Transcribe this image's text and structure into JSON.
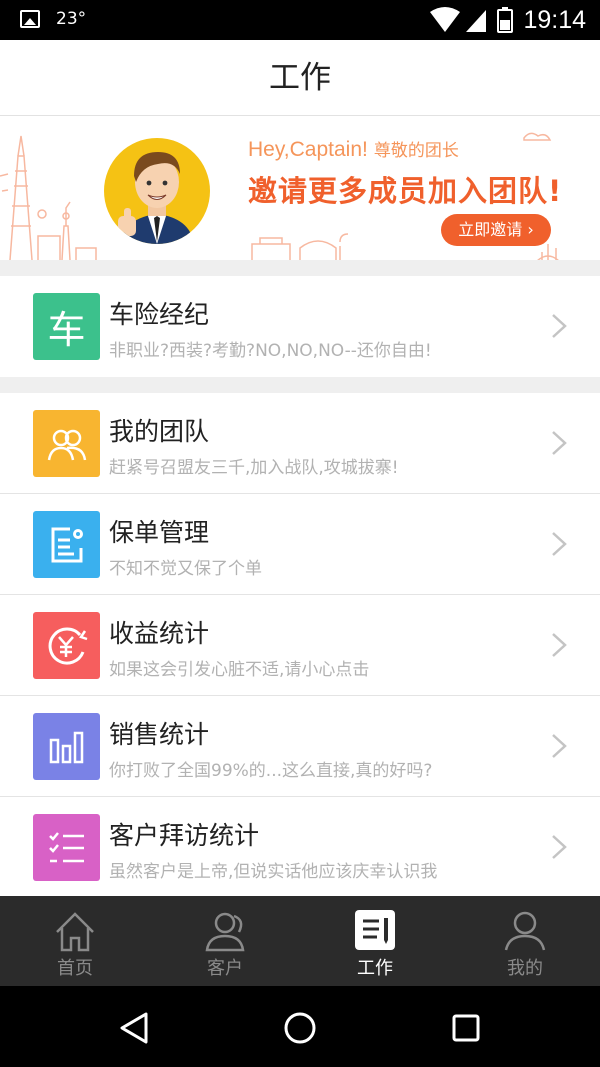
{
  "status_bar": {
    "temperature": "23°",
    "time": "19:14",
    "icons": [
      "image-icon",
      "wifi-icon",
      "signal-icon",
      "battery-icon"
    ]
  },
  "header": {
    "title": "工作"
  },
  "banner": {
    "greeting": "Hey,Captain!",
    "greeting_cn": "尊敬的团长",
    "headline": "邀请更多成员加入团队!",
    "button_label": "立即邀请 ›",
    "accent_color": "#f0602c"
  },
  "featured": {
    "icon_text": "车",
    "title": "车险经纪",
    "desc": "非职业?西装?考勤?NO,NO,NO--还你自由!",
    "color": "#3cc18c"
  },
  "menu": [
    {
      "title": "我的团队",
      "desc": "赶紧号召盟友三千,加入战队,攻城拔寨!",
      "color": "#f8b530",
      "icon": "team-icon"
    },
    {
      "title": "保单管理",
      "desc": "不知不觉又保了个单",
      "color": "#3ab0ee",
      "icon": "policy-icon"
    },
    {
      "title": "收益统计",
      "desc": "如果这会引发心脏不适,请小心点击",
      "color": "#f65e5e",
      "icon": "yuan-icon"
    },
    {
      "title": "销售统计",
      "desc": "你打败了全国99%的...这么直接,真的好吗?",
      "color": "#7a82e6",
      "icon": "bar-chart-icon"
    },
    {
      "title": "客户拜访统计",
      "desc": "虽然客户是上帝,但说实话他应该庆幸认识我",
      "color": "#d861c6",
      "icon": "checklist-icon"
    }
  ],
  "tabs": [
    {
      "label": "首页",
      "icon": "home-icon",
      "active": false
    },
    {
      "label": "客户",
      "icon": "customers-icon",
      "active": false
    },
    {
      "label": "工作",
      "icon": "work-icon",
      "active": true
    },
    {
      "label": "我的",
      "icon": "profile-icon",
      "active": false
    }
  ]
}
